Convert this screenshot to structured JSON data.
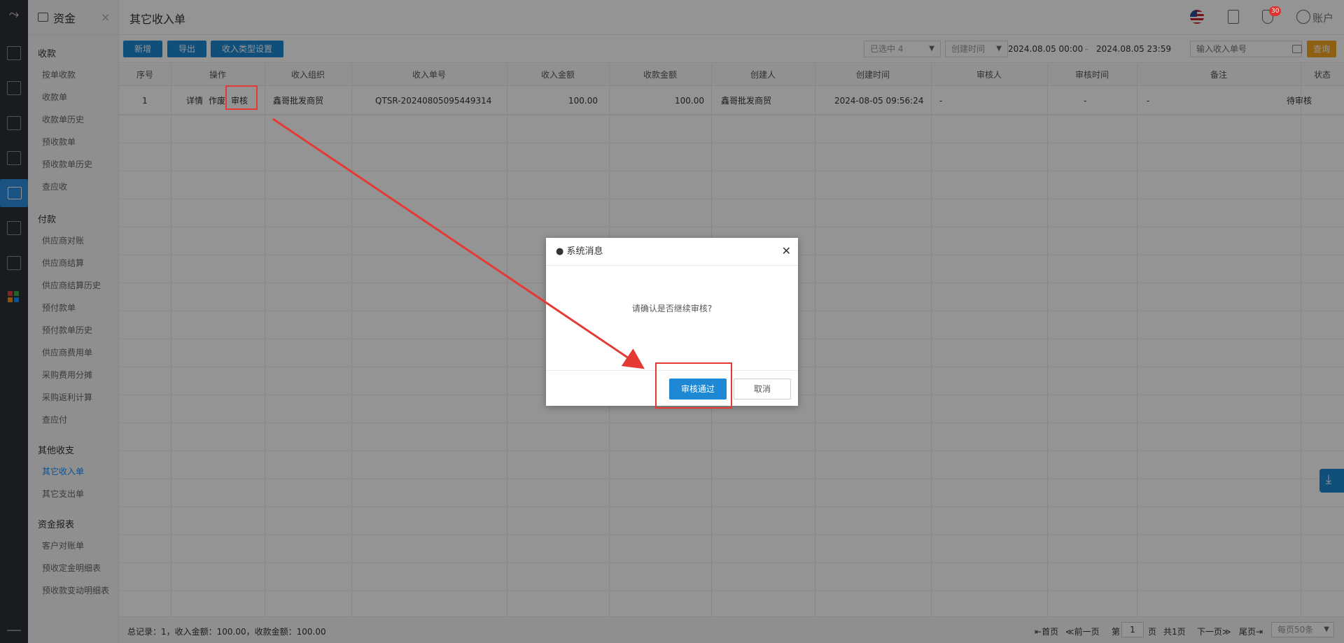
{
  "sidebar": {
    "module_title": "资金",
    "groups": [
      {
        "label": "收款",
        "items": [
          "按单收款",
          "收款单",
          "收款单历史",
          "预收款单",
          "预收款单历史",
          "查应收"
        ]
      },
      {
        "label": "付款",
        "items": [
          "供应商对账",
          "供应商结算",
          "供应商结算历史",
          "预付款单",
          "预付款单历史",
          "供应商费用单",
          "采购费用分摊",
          "采购返利计算",
          "查应付"
        ]
      },
      {
        "label": "其他收支",
        "items": [
          "其它收入单",
          "其它支出单"
        ]
      },
      {
        "label": "资金报表",
        "items": [
          "客户对账单",
          "预收定金明细表",
          "预收款变动明细表"
        ]
      }
    ],
    "active_item": "其它收入单"
  },
  "header": {
    "title": "其它收入单",
    "notification_count": "30",
    "account_label": "账户"
  },
  "toolbar": {
    "new_label": "新增",
    "export_label": "导出",
    "type_settings_label": "收入类型设置",
    "status_filter": "已选中 4",
    "time_field": "创建时间",
    "start_time": "2024.08.05 00:00",
    "range_sep": "-",
    "end_time": "2024.08.05 23:59",
    "search_placeholder": "输入收入单号",
    "query_label": "查询"
  },
  "table": {
    "columns": [
      "序号",
      "操作",
      "收入组织",
      "收入单号",
      "收入金额",
      "收款金额",
      "创建人",
      "创建时间",
      "审核人",
      "审核时间",
      "备注",
      "状态"
    ],
    "rows": [
      {
        "index": "1",
        "actions": [
          "详情",
          "作废",
          "审核"
        ],
        "org": "鑫哥批发商贸",
        "order_no": "QTSR-20240805095449314",
        "income_amount": "100.00",
        "received_amount": "100.00",
        "creator": "鑫哥批发商贸",
        "created_at": "2024-08-05 09:56:24",
        "auditor": "-",
        "audit_time": "-",
        "remark": "-",
        "status": "待审核"
      }
    ]
  },
  "footer": {
    "summary": "总记录：1，收入金额：100.00，收款金额：100.00",
    "first": "首页",
    "prev": "前一页",
    "page_prefix": "第",
    "page_value": "1",
    "page_suffix": "页",
    "total_pages": "共1页",
    "next": "下一页",
    "last": "尾页",
    "page_size": "每页50条"
  },
  "dialog": {
    "title": "● 系统消息",
    "message": "请确认是否继续审核?",
    "ok_label": "审核通过",
    "cancel_label": "取消"
  },
  "colors": {
    "primary": "#1e88d4",
    "accent_orange": "#f5a623",
    "annotation_red": "#e53935"
  }
}
